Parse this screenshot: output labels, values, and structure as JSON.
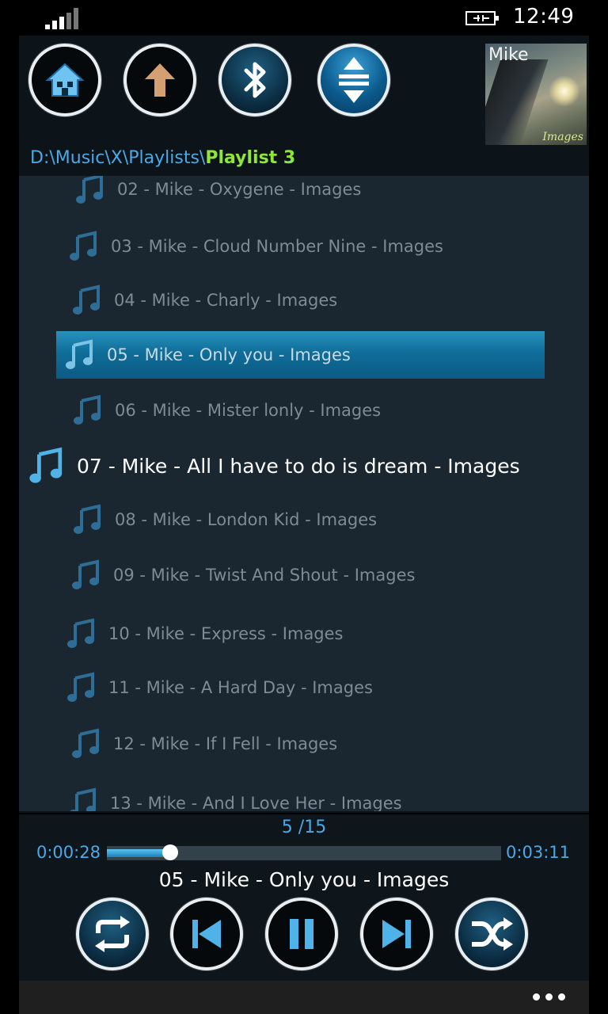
{
  "status_bar": {
    "time": "12:49",
    "signal_icon": "signal-strength-icon",
    "battery_icon": "battery-charging-icon"
  },
  "toolbar": {
    "home_icon": "home-icon",
    "up_icon": "arrow-up-icon",
    "bluetooth_icon": "bluetooth-icon",
    "expand_icon": "expand-vertical-icon"
  },
  "album_art": {
    "artist": "Mike",
    "album": "Images"
  },
  "path": {
    "prefix": "D:\\Music\\X\\Playlists\\",
    "current": "Playlist 3"
  },
  "playlist": {
    "items": [
      {
        "label": "02 - Mike - Oxygene - Images",
        "state": "normal"
      },
      {
        "label": "03 - Mike - Cloud Number Nine - Images",
        "state": "normal"
      },
      {
        "label": "04 - Mike - Charly - Images",
        "state": "normal"
      },
      {
        "label": "05 - Mike - Only you - Images",
        "state": "selected"
      },
      {
        "label": "06 - Mike -  Mister lonly - Images",
        "state": "normal"
      },
      {
        "label": "07 - Mike - All I have to do is dream - Images",
        "state": "playing"
      },
      {
        "label": "08 - Mike - London Kid - Images",
        "state": "normal"
      },
      {
        "label": "09 - Mike - Twist And Shout - Images",
        "state": "normal"
      },
      {
        "label": "10 - Mike - Express - Images",
        "state": "normal"
      },
      {
        "label": "11 - Mike - A Hard Day - Images",
        "state": "normal"
      },
      {
        "label": "12 - Mike - If I Fell  - Images",
        "state": "normal"
      },
      {
        "label": "13 - Mike - And I Love Her - Images",
        "state": "normal"
      }
    ]
  },
  "player": {
    "track_count": "5 /15",
    "elapsed": "0:00:28",
    "total": "0:03:11",
    "progress": 0.16,
    "now_playing": "05 - Mike - Only you - Images"
  },
  "colors": {
    "accent_blue": "#4aa9e8",
    "path_green": "#8ee63a",
    "selected_row": "#0f6d99"
  }
}
